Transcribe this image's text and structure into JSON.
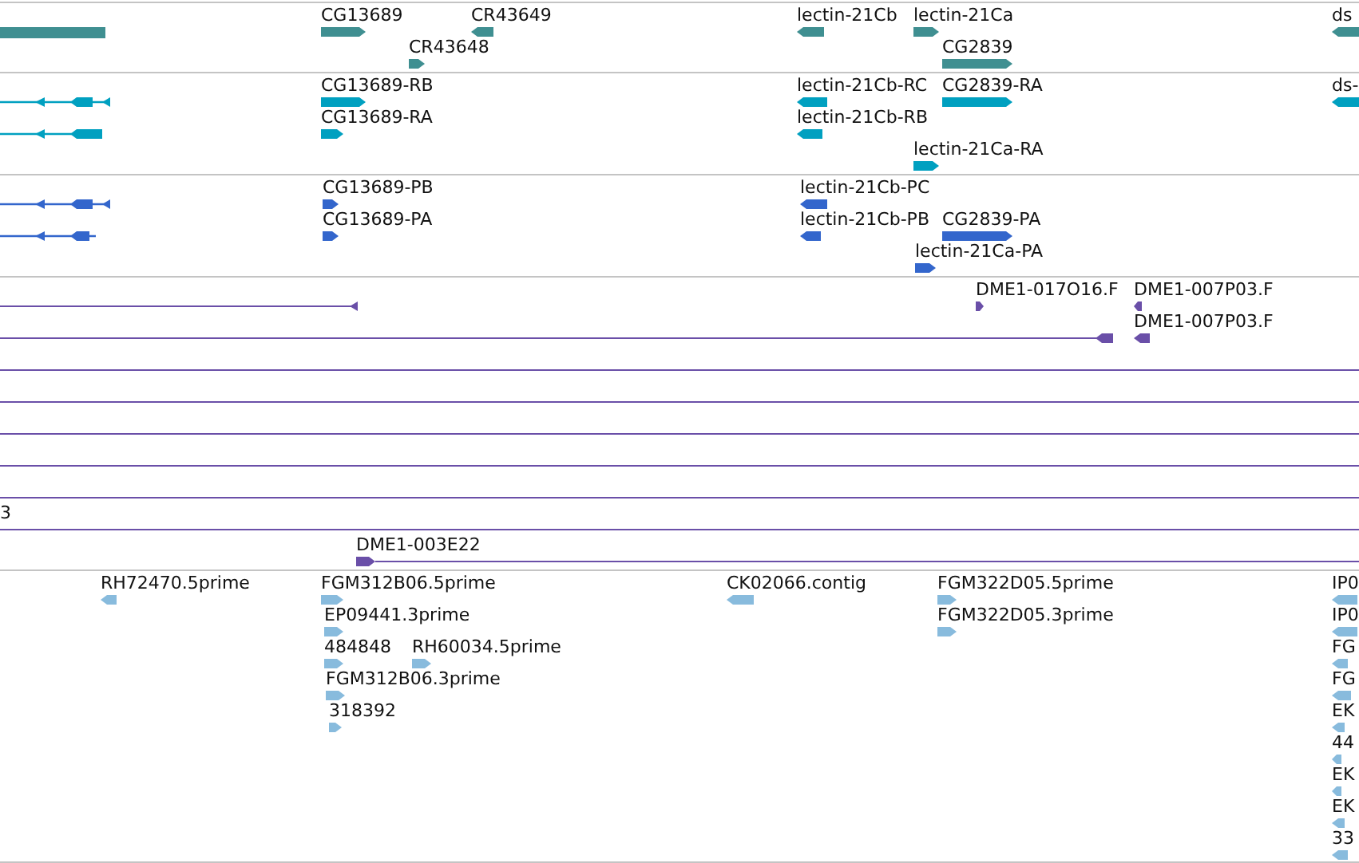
{
  "tracks": [
    {
      "color": "#3f8f91",
      "features": [
        {
          "label": "CG13689",
          "reverse": false
        },
        {
          "label": "CR43649",
          "reverse": true
        },
        {
          "label": "lectin-21Cb",
          "reverse": true
        },
        {
          "label": "lectin-21Ca",
          "reverse": false
        },
        {
          "label": "ds",
          "reverse": true
        },
        {
          "label": "CR43648",
          "reverse": false
        },
        {
          "label": "CG2839",
          "reverse": false
        }
      ]
    },
    {
      "color": "#00a0c0",
      "features": [
        {
          "label": "CG13689-RB",
          "reverse": false
        },
        {
          "label": "lectin-21Cb-RC",
          "reverse": true
        },
        {
          "label": "CG2839-RA",
          "reverse": false
        },
        {
          "label": "ds-",
          "reverse": true
        },
        {
          "label": "CG13689-RA",
          "reverse": false
        },
        {
          "label": "lectin-21Cb-RB",
          "reverse": true
        },
        {
          "label": "lectin-21Ca-RA",
          "reverse": false
        }
      ]
    },
    {
      "color": "#3366cc",
      "features": [
        {
          "label": "CG13689-PB",
          "reverse": false
        },
        {
          "label": "lectin-21Cb-PC",
          "reverse": true
        },
        {
          "label": "CG13689-PA",
          "reverse": false
        },
        {
          "label": "lectin-21Cb-PB",
          "reverse": true
        },
        {
          "label": "CG2839-PA",
          "reverse": false
        },
        {
          "label": "lectin-21Ca-PA",
          "reverse": false
        }
      ]
    },
    {
      "color": "#6a4fa8",
      "features": [
        {
          "label": "DME1-017O16.F",
          "reverse": false
        },
        {
          "label": "DME1-007P03.F",
          "reverse": true
        },
        {
          "label": "DME1-007P03.F",
          "reverse": true
        },
        {
          "label": "3"
        },
        {
          "label": "DME1-003E22",
          "reverse": false
        }
      ]
    },
    {
      "color": "#88bbdd",
      "features": [
        {
          "label": "RH72470.5prime",
          "reverse": true
        },
        {
          "label": "FGM312B06.5prime",
          "reverse": false
        },
        {
          "label": "CK02066.contig",
          "reverse": true
        },
        {
          "label": "FGM322D05.5prime",
          "reverse": false
        },
        {
          "label": "IP0",
          "reverse": true
        },
        {
          "label": "EP09441.3prime",
          "reverse": false
        },
        {
          "label": "FGM322D05.3prime",
          "reverse": false
        },
        {
          "label": "IP0",
          "reverse": true
        },
        {
          "label": "484848",
          "reverse": false
        },
        {
          "label": "RH60034.5prime",
          "reverse": false
        },
        {
          "label": "FG",
          "reverse": true
        },
        {
          "label": "FGM312B06.3prime",
          "reverse": false
        },
        {
          "label": "FG",
          "reverse": true
        },
        {
          "label": "318392",
          "reverse": false
        },
        {
          "label": "EK",
          "reverse": true
        },
        {
          "label": "44",
          "reverse": true
        },
        {
          "label": "EK",
          "reverse": true
        },
        {
          "label": "EK",
          "reverse": true
        },
        {
          "label": "33",
          "reverse": true
        }
      ]
    }
  ]
}
